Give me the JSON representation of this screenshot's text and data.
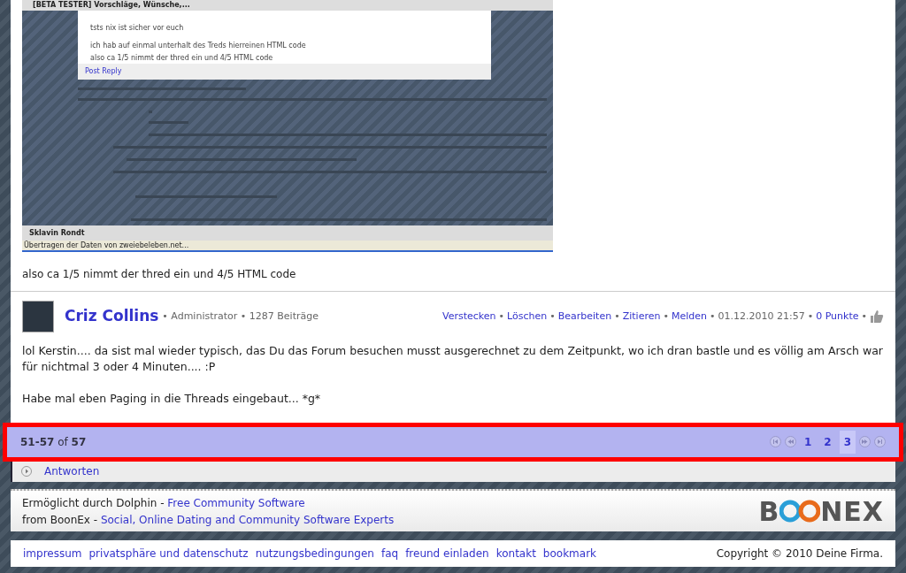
{
  "embedded_screenshot": {
    "tab_title": "[BETA TESTER] Vorschläge, Wünsche,...",
    "post_lines": [
      "tsts nix ist sicher vor euch",
      "ich hab auf einmal unterhalt des Treds hierreinen HTML code",
      "also ca 1/5 nimmt der thred ein und 4/5 HTML code"
    ],
    "post_reply": "Post Reply",
    "taskbar_user": "Sklavin Rondt",
    "status_text": "Übertragen der Daten von zweiebeleben.net..."
  },
  "post_caption": "also ca 1/5 nimmt der thred ein und 4/5 HTML code",
  "post": {
    "author": "Criz Collins",
    "role": "Administrator",
    "post_count": "1287 Beiträge",
    "actions": [
      "Verstecken",
      "Löschen",
      "Bearbeiten",
      "Zitieren",
      "Melden"
    ],
    "date": "01.12.2010 21:57",
    "points": "0 Punkte",
    "separator": "•",
    "paragraphs": [
      "lol Kerstin.... da sist mal wieder typisch, das Du das Forum besuchen musst ausgerechnet zu dem Zeitpunkt, wo ich dran bastle und es völlig am Arsch war für nichtmal 3 oder 4 Minuten.... :P",
      "Habe mal eben Paging in die Threads eingebaut... *g*"
    ]
  },
  "paging": {
    "range": "51-57",
    "of": "of",
    "total": "57",
    "pages": [
      {
        "label": "1",
        "selected": false
      },
      {
        "label": "2",
        "selected": false
      },
      {
        "label": "3",
        "selected": true
      }
    ]
  },
  "reply_link": "Antworten",
  "footer": {
    "powered_prefix": "Ermöglicht durch Dolphin -",
    "powered_link": "Free Community Software",
    "from_prefix": "from BoonEx -",
    "from_link": "Social, Online Dating and Community Software Experts",
    "logo_left": "B",
    "logo_right": "NEX",
    "links": [
      "impressum",
      "privatsphäre und datenschutz",
      "nutzungsbedingungen",
      "faq",
      "freund einladen",
      "kontakt",
      "bookmark"
    ],
    "copyright": "Copyright © 2010 Deine Firma."
  }
}
